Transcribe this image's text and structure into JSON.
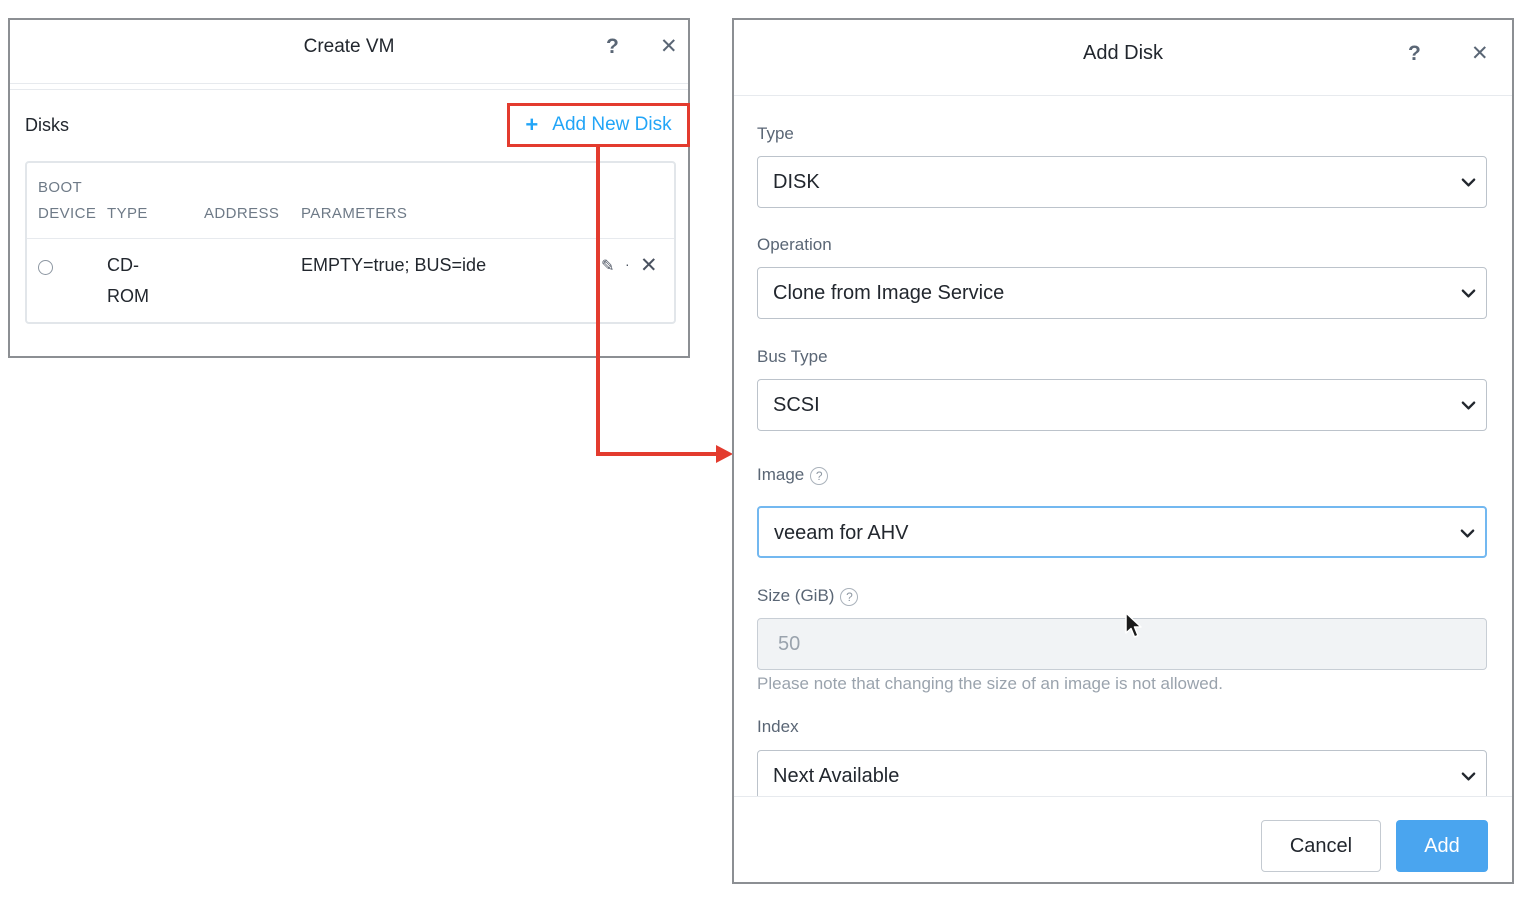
{
  "create_vm": {
    "title": "Create VM",
    "help_icon": "question-icon",
    "close_icon": "close-icon",
    "disks_section": {
      "label": "Disks",
      "add_new_disk_label": "Add New Disk",
      "add_icon": "plus-icon",
      "highlight_color": "#e33b2e",
      "table": {
        "columns": [
          "BOOT",
          "DEVICE",
          "TYPE",
          "ADDRESS",
          "PARAMETERS"
        ],
        "rows": [
          {
            "boot_device_selected": false,
            "type_line1": "CD-",
            "type_line2": "ROM",
            "address": "",
            "parameters": "EMPTY=true; BUS=ide",
            "edit_icon": "pencil-icon",
            "separator": "·",
            "delete_icon": "close-icon"
          }
        ]
      }
    }
  },
  "add_disk": {
    "title": "Add Disk",
    "help_icon": "question-icon",
    "close_icon": "close-icon",
    "fields": {
      "type": {
        "label": "Type",
        "value": "DISK"
      },
      "operation": {
        "label": "Operation",
        "value": "Clone from Image Service"
      },
      "bus_type": {
        "label": "Bus Type",
        "value": "SCSI"
      },
      "image": {
        "label": "Image",
        "value": "veeam for AHV",
        "help": "?"
      },
      "size": {
        "label": "Size (GiB)",
        "value": "50",
        "help": "?",
        "note": "Please note that changing the size of an image is not allowed."
      },
      "index": {
        "label": "Index",
        "value": "Next Available"
      }
    },
    "buttons": {
      "cancel": "Cancel",
      "add": "Add"
    },
    "accent_color": "#4aa5ef"
  }
}
